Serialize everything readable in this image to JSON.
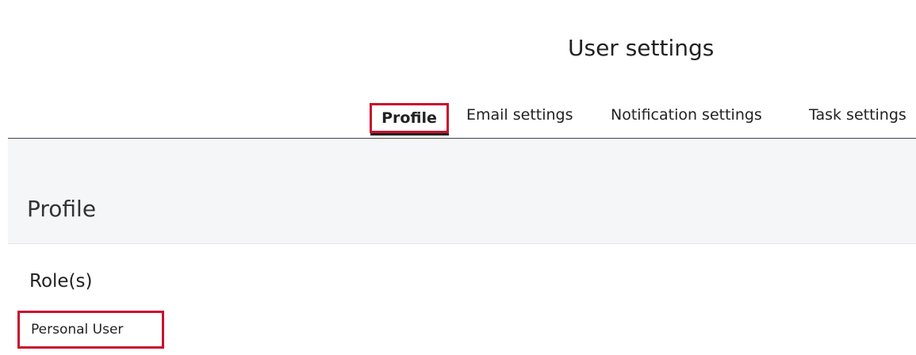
{
  "header": {
    "title": "User settings"
  },
  "tabs": [
    {
      "label": "Profile",
      "active": true
    },
    {
      "label": "Email settings",
      "active": false
    },
    {
      "label": "Notification settings",
      "active": false
    },
    {
      "label": "Task settings",
      "active": false
    }
  ],
  "profile": {
    "heading": "Profile",
    "roles_title": "Role(s)",
    "roles": [
      "Personal User"
    ]
  },
  "colors": {
    "highlight_border": "#c8102e",
    "content_background": "#f5f6f8",
    "active_tab_underline": "#222222"
  }
}
